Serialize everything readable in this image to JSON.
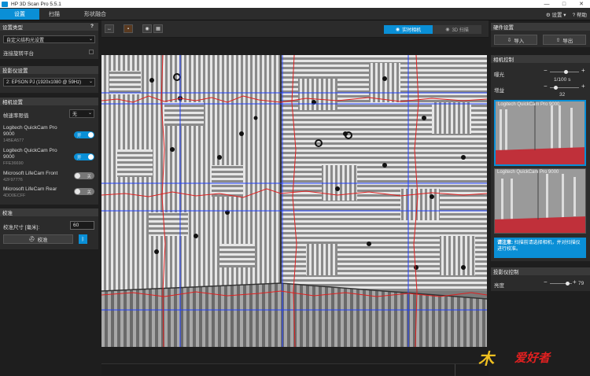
{
  "window": {
    "title": "HP 3D Scan Pro 5.5.1",
    "controls": [
      "—",
      "□",
      "✕"
    ]
  },
  "menu": {
    "tabs": [
      "设置",
      "扫描",
      "形状融合"
    ],
    "settings_label": "设置",
    "help_label": "帮助"
  },
  "left": {
    "setup_type": {
      "header": "设置类型",
      "help": "?",
      "selected": "自定义结构光设置",
      "turntable_label": "连接旋转平台"
    },
    "projector": {
      "header": "投影仪设置",
      "selected": "2: EPSON PJ (1920x1080 @ 59Hz)"
    },
    "camera": {
      "header": "相机设置",
      "frame_rate_label": "帧速率限值",
      "frame_rate_value": "无",
      "devices": [
        {
          "name": "Logitech QuickCam Pro 9000",
          "id": "14BEA577",
          "state": "开"
        },
        {
          "name": "Logitech QuickCam Pro 9000",
          "id": "FFE36690",
          "state": "开"
        },
        {
          "name": "Microsoft LifeCam Front",
          "id": "42F97776",
          "state": "关"
        },
        {
          "name": "Microsoft LifeCam Rear",
          "id": "4DD0ECFF",
          "state": "关"
        }
      ]
    },
    "calibration": {
      "header": "校准",
      "size_label": "校准尺寸 [毫米]:",
      "size_value": "60",
      "calibrate_button": "校准",
      "bluetooth_button": "ᛒ"
    }
  },
  "toolbar": {
    "live_camera": "实时相机",
    "scan_3d": "3D 扫描"
  },
  "right": {
    "hardware": {
      "header": "硬件设置",
      "import_label": "导入",
      "export_label": "导出"
    },
    "camera_control": {
      "header": "相机控制",
      "exposure_label": "曝光",
      "exposure_value": "1/100 s",
      "exposure_level": 0.55,
      "gain_label": "增益",
      "gain_value": "32",
      "gain_level": 0.2,
      "thumbs": [
        "Logitech QuickCam Pro 9000",
        "Logitech QuickCam Pro 9000"
      ],
      "note_bold": "请注意:",
      "note_text": "扫描前请选择相机，并对扫描仪进行校准。"
    },
    "projector_control": {
      "header": "投影仪控制",
      "brightness_label": "亮度",
      "brightness_value": "79",
      "brightness_level": 0.79
    }
  },
  "watermark": {
    "text": "爱好者",
    "mark": "木"
  },
  "colors": {
    "accent": "#0a8fd6",
    "scan_line": "#e02020",
    "grid_line": "#2040ff"
  }
}
